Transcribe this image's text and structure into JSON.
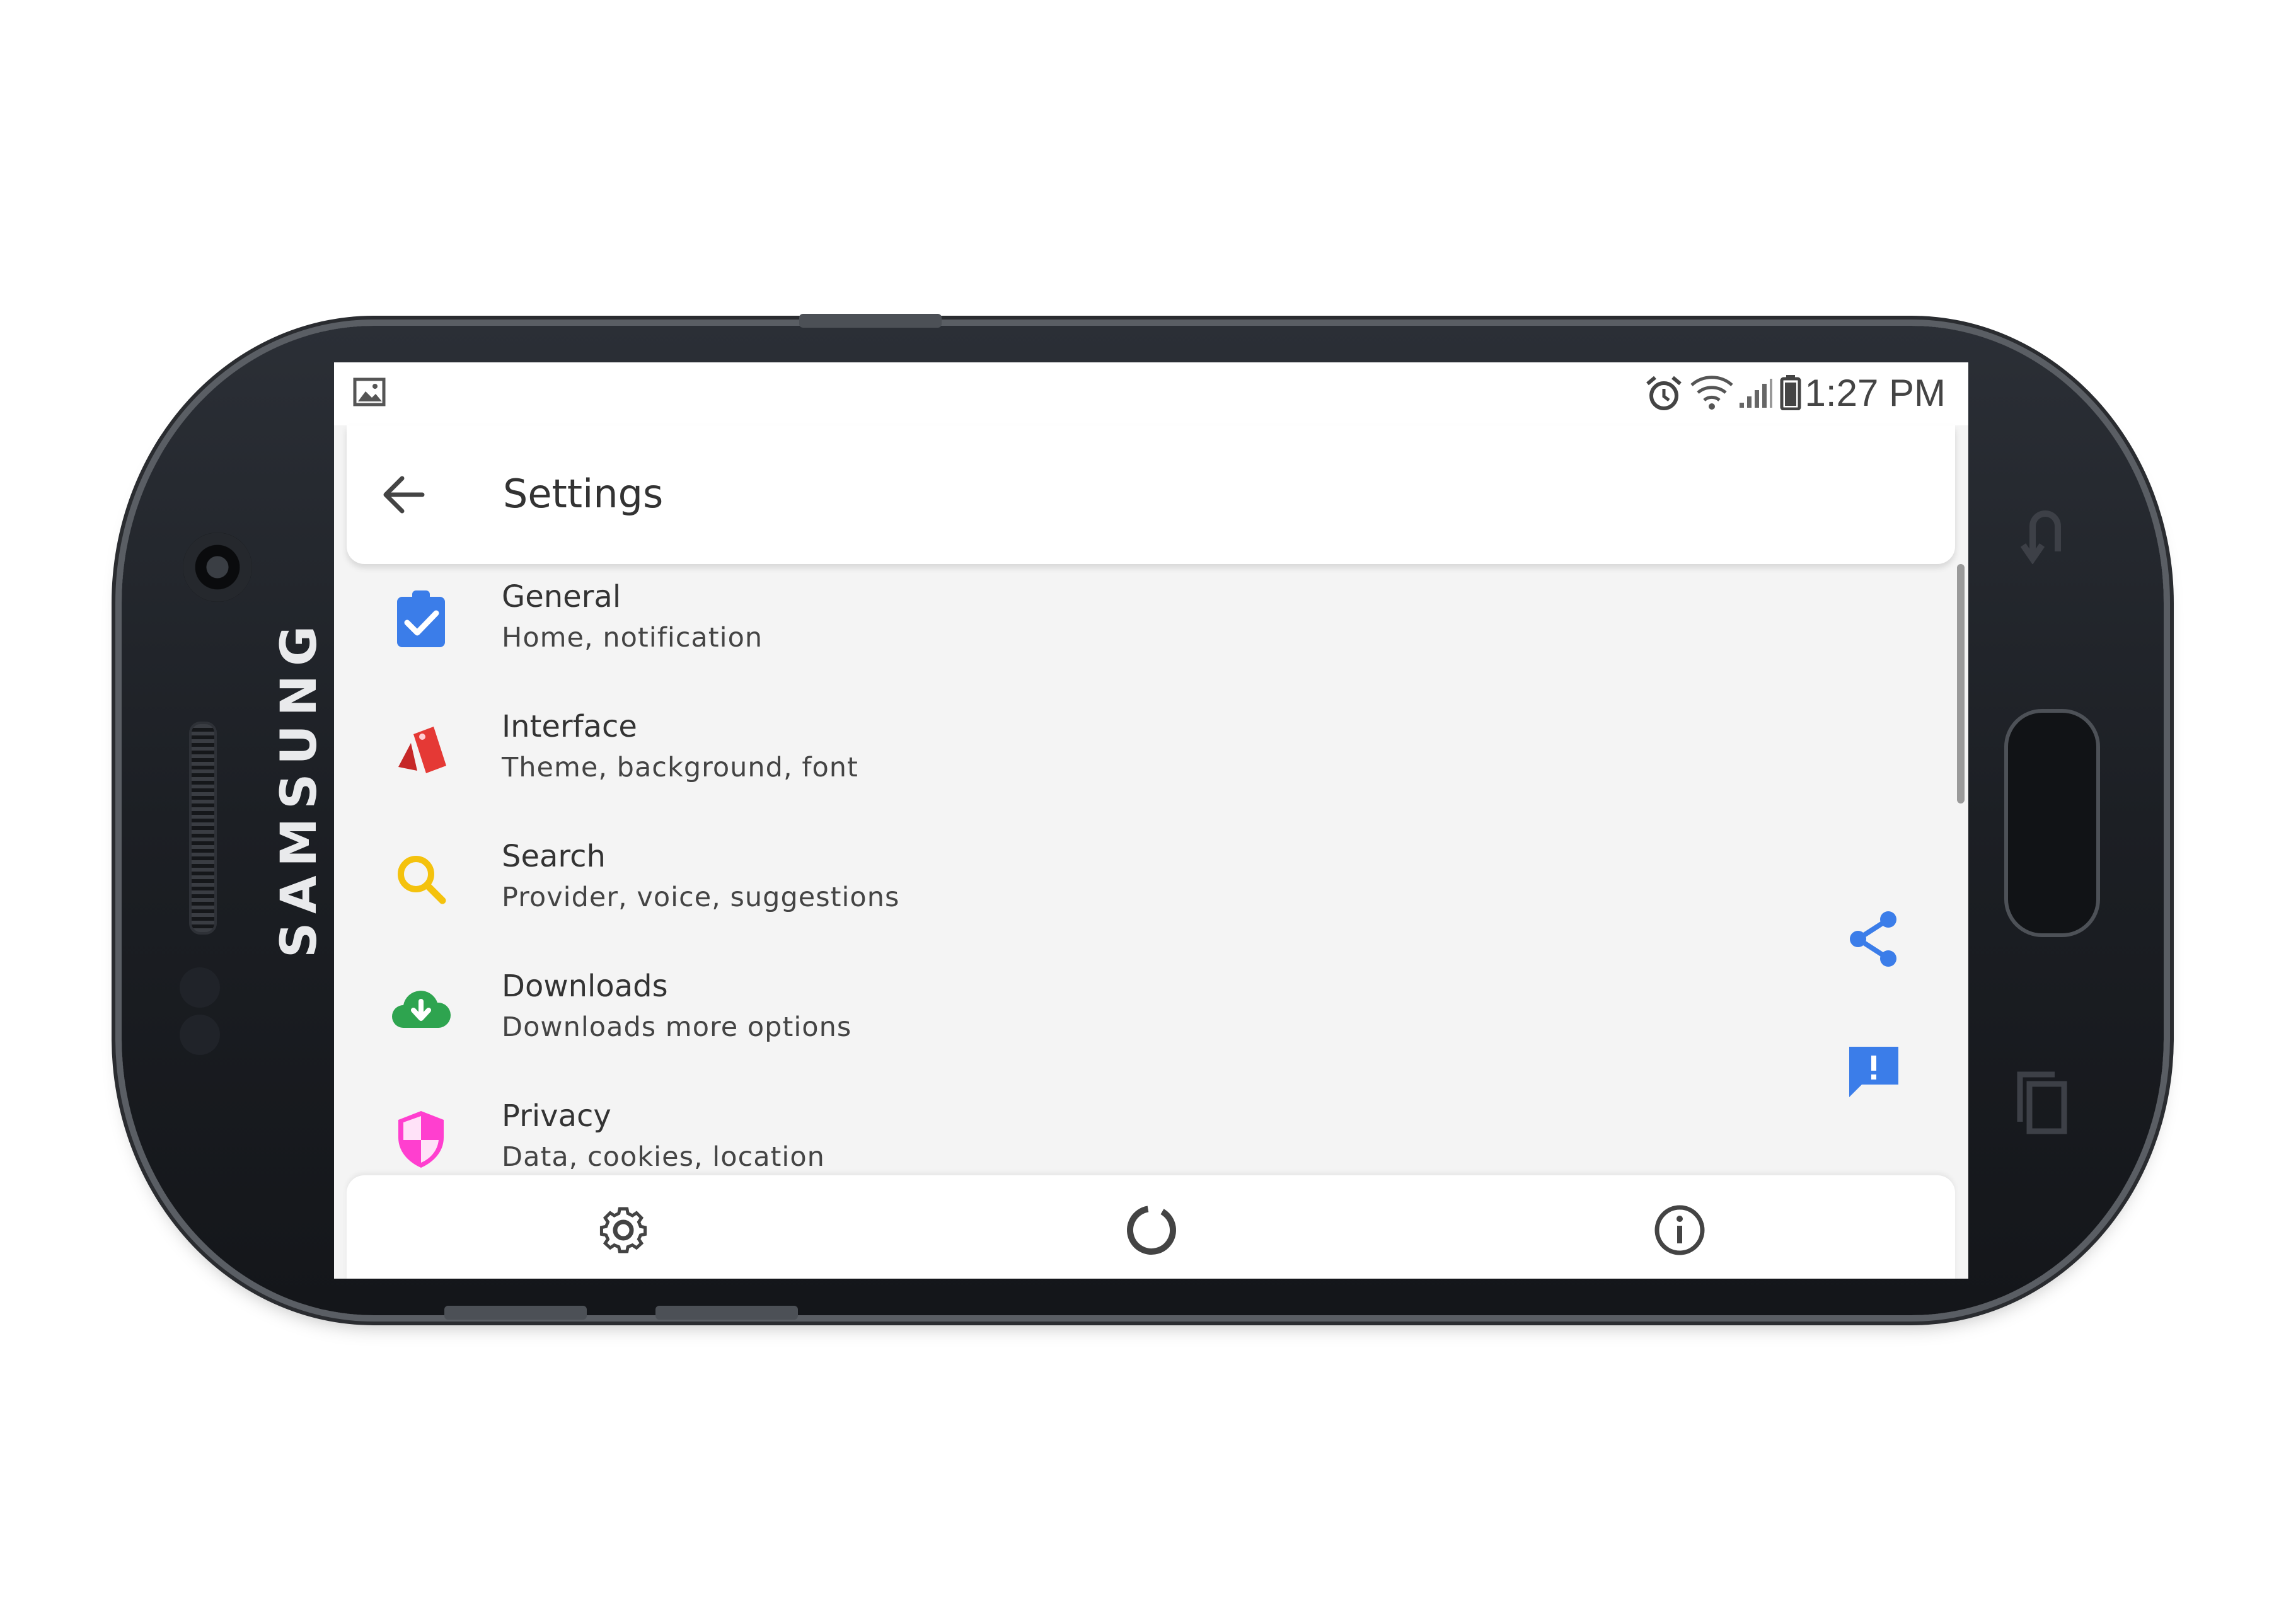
{
  "device": {
    "brand": "SAMSUNG"
  },
  "status_bar": {
    "time": "1:27 PM",
    "icons": [
      "image-notification-icon",
      "alarm-icon",
      "wifi-icon",
      "signal-icon",
      "battery-icon"
    ]
  },
  "app_bar": {
    "title": "Settings",
    "back_icon": "arrow-left-icon"
  },
  "settings_items": [
    {
      "id": "general",
      "title": "General",
      "subtitle": "Home, notification",
      "icon": "clipboard-check-icon",
      "color": "#3b7de9"
    },
    {
      "id": "interface",
      "title": "Interface",
      "subtitle": "Theme, background, font",
      "icon": "swatch-cards-icon",
      "color": "#e53935"
    },
    {
      "id": "search",
      "title": "Search",
      "subtitle": "Provider, voice, suggestions",
      "icon": "magnifier-icon",
      "color": "#f4c20d"
    },
    {
      "id": "downloads",
      "title": "Downloads",
      "subtitle": "Downloads more options",
      "icon": "cloud-download-icon",
      "color": "#2ea44f"
    },
    {
      "id": "privacy",
      "title": "Privacy",
      "subtitle": "Data, cookies, location",
      "icon": "shield-icon",
      "color": "#ff3fcf"
    }
  ],
  "floating_actions": [
    {
      "id": "share",
      "icon": "share-icon",
      "color": "#3b7de9"
    },
    {
      "id": "feedback",
      "icon": "feedback-icon",
      "color": "#3b7de9"
    }
  ],
  "bottom_nav": [
    {
      "id": "settings",
      "icon": "gear-icon"
    },
    {
      "id": "loading",
      "icon": "progress-ring-icon"
    },
    {
      "id": "about",
      "icon": "info-icon"
    }
  ],
  "hardware_keys": [
    "back-key-icon",
    "recents-key-icon"
  ]
}
